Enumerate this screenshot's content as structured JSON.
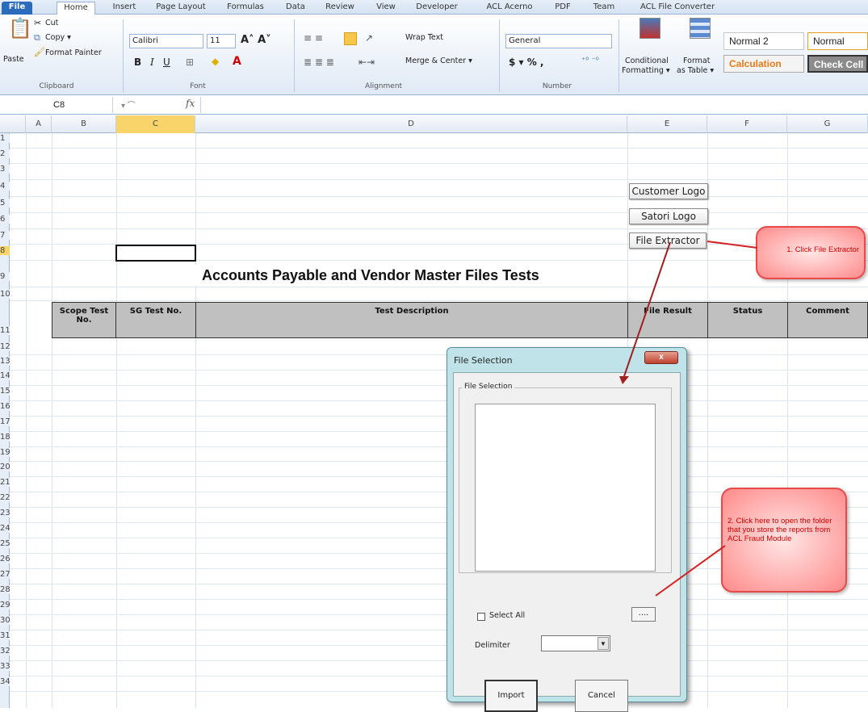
{
  "tabs": [
    "File",
    "Home",
    "Insert",
    "Page Layout",
    "Formulas",
    "Data",
    "Review",
    "View",
    "Developer",
    "ACL Acerno",
    "PDF",
    "Team",
    "ACL File Converter"
  ],
  "ribbon": {
    "clipboard": {
      "paste": "Paste",
      "cut": "Cut",
      "copy": "Copy ▾",
      "format_painter": "Format Painter",
      "label": "Clipboard"
    },
    "font": {
      "name": "Calibri",
      "size": "11",
      "label": "Font"
    },
    "alignment": {
      "wrap": "Wrap Text",
      "merge": "Merge & Center ▾",
      "label": "Alignment"
    },
    "number": {
      "format": "General",
      "label": "Number"
    },
    "styles": {
      "conditional": "Conditional",
      "conditional2": "Formatting ▾",
      "format_table": "Format",
      "format_table2": "as Table ▾",
      "normal2": "Normal 2",
      "normal": "Normal",
      "calculation": "Calculation",
      "check_cell": "Check Cell"
    }
  },
  "formula_bar": {
    "cell_ref": "C8",
    "fx": "fx"
  },
  "columns": [
    "A",
    "B",
    "C",
    "D",
    "E",
    "F",
    "G"
  ],
  "rows": [
    "1",
    "2",
    "3",
    "4",
    "5",
    "6",
    "7",
    "8",
    "9",
    "10",
    "11",
    "12",
    "13",
    "14",
    "15",
    "16",
    "17",
    "18",
    "19",
    "20",
    "21",
    "22",
    "23",
    "24",
    "25",
    "26",
    "27",
    "28",
    "29",
    "30",
    "31",
    "32",
    "33",
    "34"
  ],
  "sheet": {
    "title": "Accounts Payable and Vendor Master Files Tests",
    "buttons": {
      "customer_logo": "Customer Logo",
      "satori_logo": "Satori Logo",
      "file_extractor": "File Extractor"
    },
    "headers": {
      "scope": "Scope Test No.",
      "sg": "SG Test No.",
      "desc": "Test Description",
      "file_result": "File Result",
      "status": "Status",
      "comment": "Comment"
    }
  },
  "callouts": {
    "one": "1. Click File Extractor",
    "two": "2. Click here to open the folder that you store the  reports from ACL Fraud Module"
  },
  "dialog": {
    "title": "File Selection",
    "group": "File Selection",
    "select_all": "Select All",
    "browse": "....",
    "delimiter": "Delimiter",
    "import": "Import",
    "cancel": "Cancel",
    "close": "x"
  },
  "colors": {
    "callout_red": "#e84a4a",
    "header_gray": "#c0c0c0",
    "dialog_teal": "#bfe3e8"
  }
}
